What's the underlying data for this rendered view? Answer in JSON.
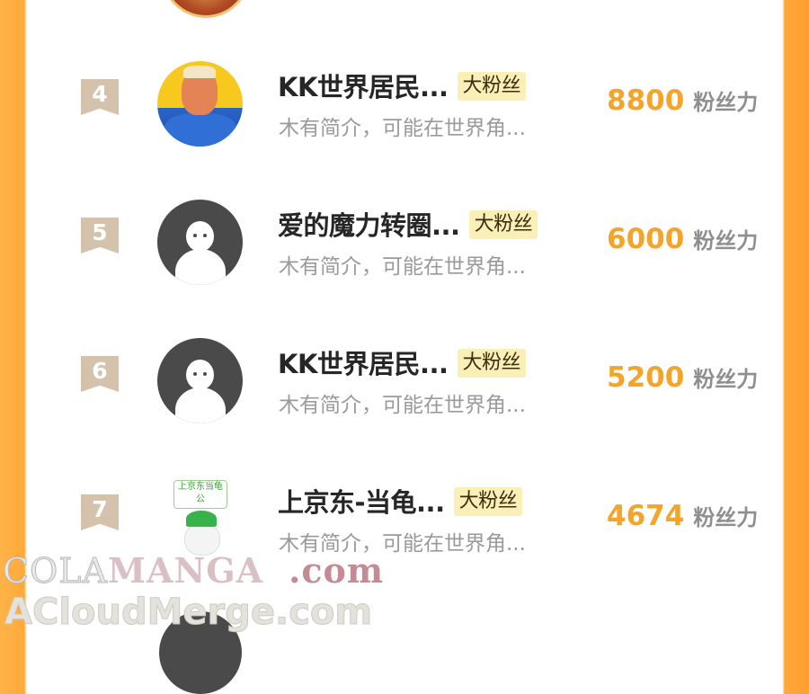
{
  "rows": [
    {
      "rank": "4",
      "name": "KK世界居民...",
      "badge": "大粉丝",
      "intro": "木有简介，可能在世界角...",
      "score": "8800",
      "score_unit": "粉丝力",
      "avatar": "photo-avatar"
    },
    {
      "rank": "5",
      "name": "爱的魔力转圈...",
      "badge": "大粉丝",
      "intro": "木有简介，可能在世界角...",
      "score": "6000",
      "score_unit": "粉丝力",
      "avatar": "default-avatar"
    },
    {
      "rank": "6",
      "name": "KK世界居民...",
      "badge": "大粉丝",
      "intro": "木有简介，可能在世界角...",
      "score": "5200",
      "score_unit": "粉丝力",
      "avatar": "default-avatar"
    },
    {
      "rank": "7",
      "name": "上京东-当龟...",
      "badge": "大粉丝",
      "intro": "木有简介，可能在世界角...",
      "score": "4674",
      "score_unit": "粉丝力",
      "avatar": "jd-avatar",
      "avatar_sign": "上京东当龟公"
    }
  ],
  "watermark": {
    "line1_a": "COLA",
    "line1_b": "MANGA",
    "line1_c": ".com",
    "line2": "ACloudMerge.com"
  },
  "colors": {
    "accent": "#f4a42a",
    "badge_bg": "#fbefb8",
    "rank_bg": "#d5c2ad",
    "side": "#ffa93a"
  }
}
